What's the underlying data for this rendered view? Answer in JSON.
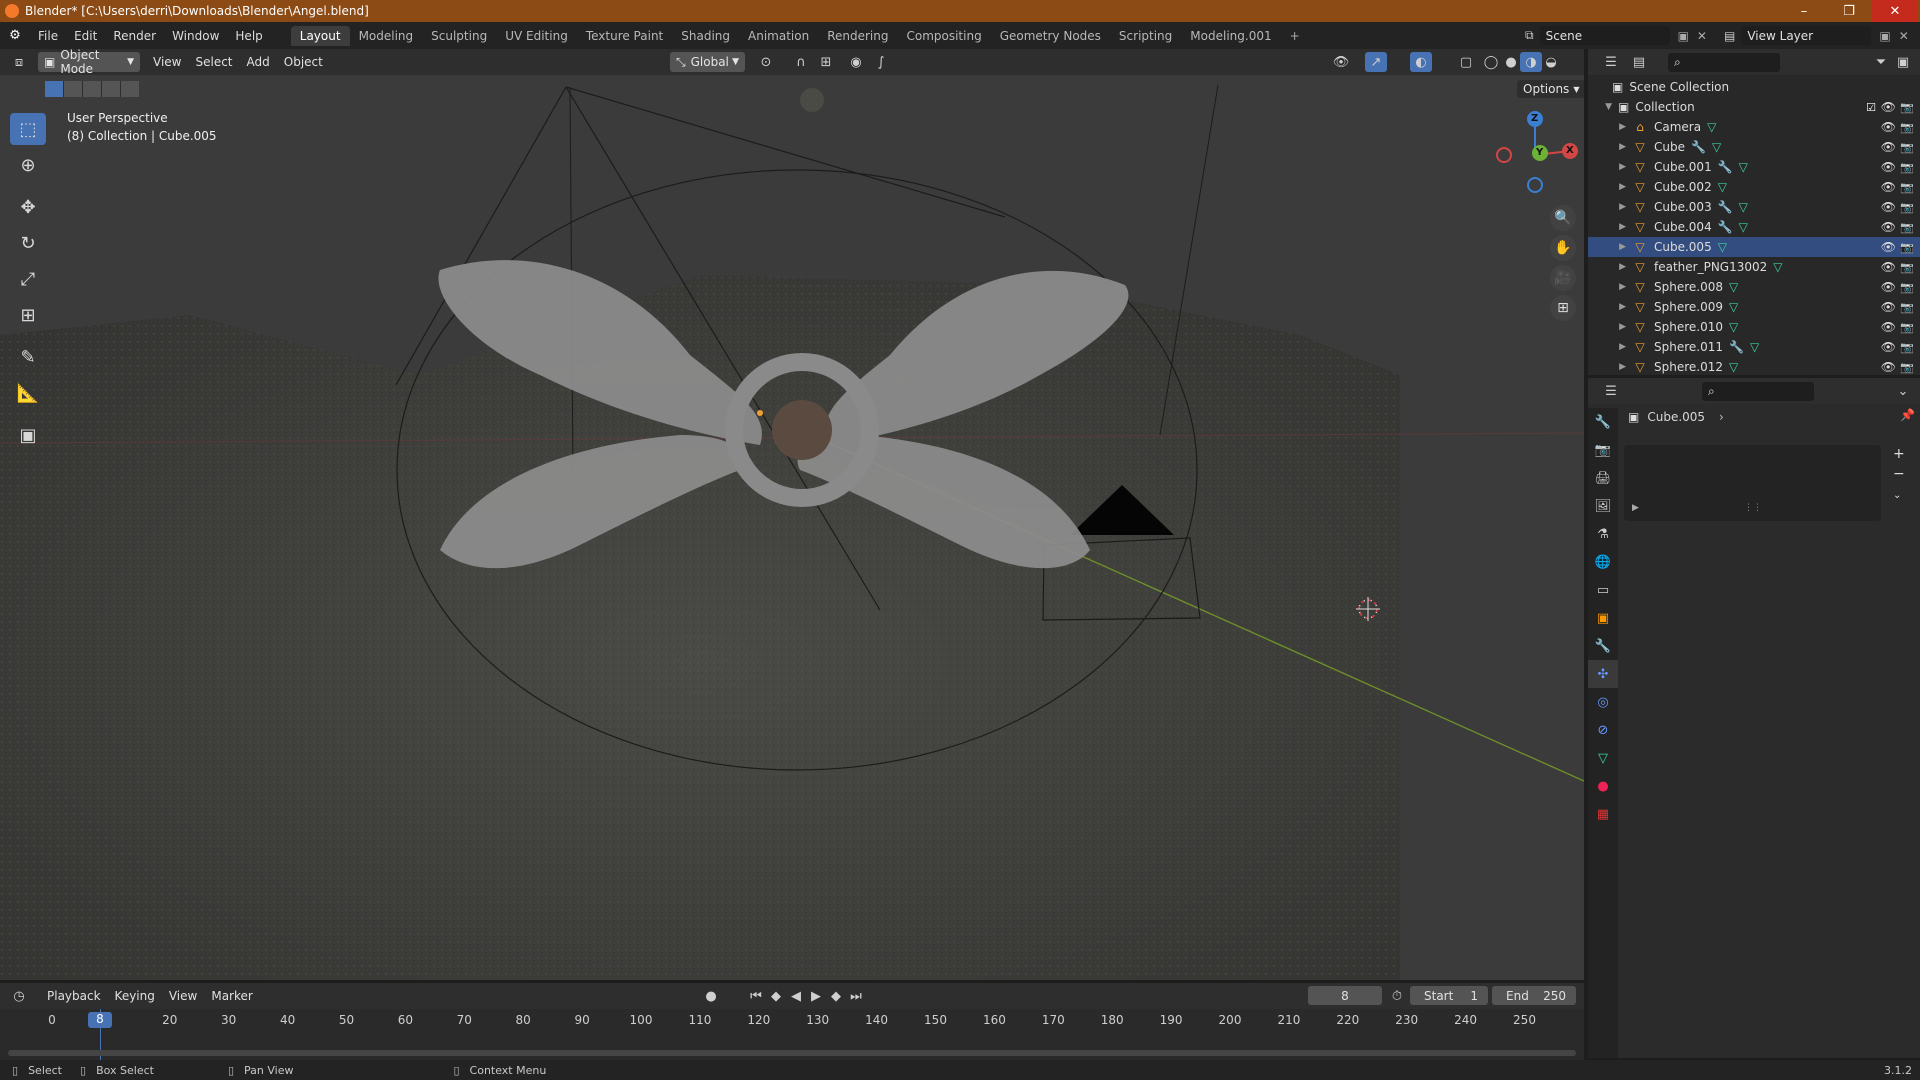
{
  "window": {
    "title": "Blender* [C:\\Users\\derri\\Downloads\\Blender\\Angel.blend]",
    "minimize": "–",
    "maximize": "❐",
    "close": "✕"
  },
  "menu": [
    "File",
    "Edit",
    "Render",
    "Window",
    "Help"
  ],
  "workspaces": [
    "Layout",
    "Modeling",
    "Sculpting",
    "UV Editing",
    "Texture Paint",
    "Shading",
    "Animation",
    "Rendering",
    "Compositing",
    "Geometry Nodes",
    "Scripting",
    "Modeling.001"
  ],
  "workspace_add": "+",
  "scene": {
    "name": "Scene",
    "view_layer": "View Layer"
  },
  "viewport_header": {
    "mode": "Object Mode",
    "menus": [
      "View",
      "Select",
      "Add",
      "Object"
    ],
    "transform_orientation": "Global",
    "options": "Options"
  },
  "viewport": {
    "perspective": "User Perspective",
    "collection_info": "(8) Collection | Cube.005",
    "gizmo": {
      "z": "Z",
      "y": "Y",
      "x": "X"
    }
  },
  "outliner": {
    "root": "Scene Collection",
    "collection": "Collection",
    "items": [
      {
        "name": "Camera",
        "selected": false,
        "modifier": false
      },
      {
        "name": "Cube",
        "selected": false,
        "modifier": true
      },
      {
        "name": "Cube.001",
        "selected": false,
        "modifier": true
      },
      {
        "name": "Cube.002",
        "selected": false,
        "modifier": false
      },
      {
        "name": "Cube.003",
        "selected": false,
        "modifier": true
      },
      {
        "name": "Cube.004",
        "selected": false,
        "modifier": true
      },
      {
        "name": "Cube.005",
        "selected": true,
        "modifier": false
      },
      {
        "name": "feather_PNG13002",
        "selected": false,
        "modifier": false
      },
      {
        "name": "Sphere.008",
        "selected": false,
        "modifier": false
      },
      {
        "name": "Sphere.009",
        "selected": false,
        "modifier": false
      },
      {
        "name": "Sphere.010",
        "selected": false,
        "modifier": false
      },
      {
        "name": "Sphere.011",
        "selected": false,
        "modifier": true
      },
      {
        "name": "Sphere.012",
        "selected": false,
        "modifier": false
      }
    ]
  },
  "properties": {
    "object_name": "Cube.005"
  },
  "timeline": {
    "menus": [
      "Playback",
      "Keying",
      "View",
      "Marker"
    ],
    "current_frame": "8",
    "start_label": "Start",
    "start": "1",
    "end_label": "End",
    "end": "250",
    "ticks": [
      "0",
      "8",
      "20",
      "30",
      "40",
      "50",
      "60",
      "70",
      "80",
      "90",
      "100",
      "110",
      "120",
      "130",
      "140",
      "150",
      "160",
      "170",
      "180",
      "190",
      "200",
      "210",
      "220",
      "230",
      "240",
      "250"
    ]
  },
  "statusbar": {
    "select": "Select",
    "box_select": "Box Select",
    "pan_view": "Pan View",
    "context_menu": "Context Menu",
    "version": "3.1.2"
  }
}
